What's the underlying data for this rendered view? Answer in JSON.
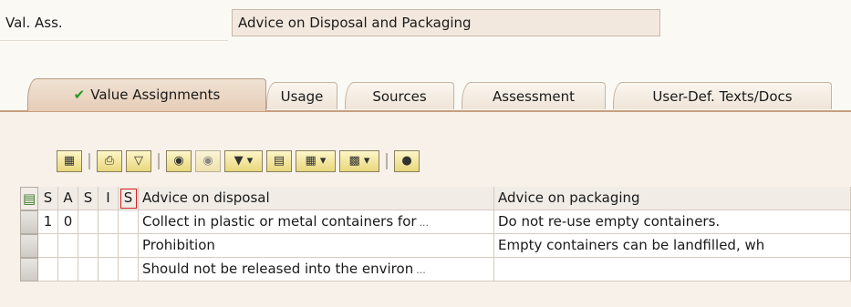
{
  "header": {
    "label": "Val. Ass.",
    "value": "Advice on Disposal and Packaging"
  },
  "tabs": [
    {
      "label": "Value Assignments",
      "active": true,
      "check_icon": "checkmark-icon"
    },
    {
      "label": "Usage"
    },
    {
      "label": "Sources"
    },
    {
      "label": "Assessment"
    },
    {
      "label": "User-Def. Texts/Docs"
    }
  ],
  "toolbar": {
    "buttons": [
      "details-icon",
      "print-icon",
      "filter-icon",
      "find-icon",
      "find-next-icon",
      "set-filter-icon",
      "print-preview-icon",
      "export-icon",
      "change-layout-icon",
      "info-icon"
    ]
  },
  "grid": {
    "select_all_icon": "select-all-icon",
    "columns": [
      "S",
      "A",
      "S",
      "I",
      "S",
      "Advice on disposal",
      "Advice on packaging"
    ],
    "rows": [
      {
        "c1": "1",
        "c2": "0",
        "c3": "",
        "c4": "",
        "c5": "",
        "disposal": "Collect in plastic or metal containers for",
        "packaging": "Do not re-use empty containers."
      },
      {
        "c1": "",
        "c2": "",
        "c3": "",
        "c4": "",
        "c5": "",
        "disposal": "Prohibition",
        "packaging": "Empty containers can be landfilled, wh"
      },
      {
        "c1": "",
        "c2": "",
        "c3": "",
        "c4": "",
        "c5": "",
        "disposal": "Should not be released into the environ",
        "packaging": ""
      }
    ]
  }
}
